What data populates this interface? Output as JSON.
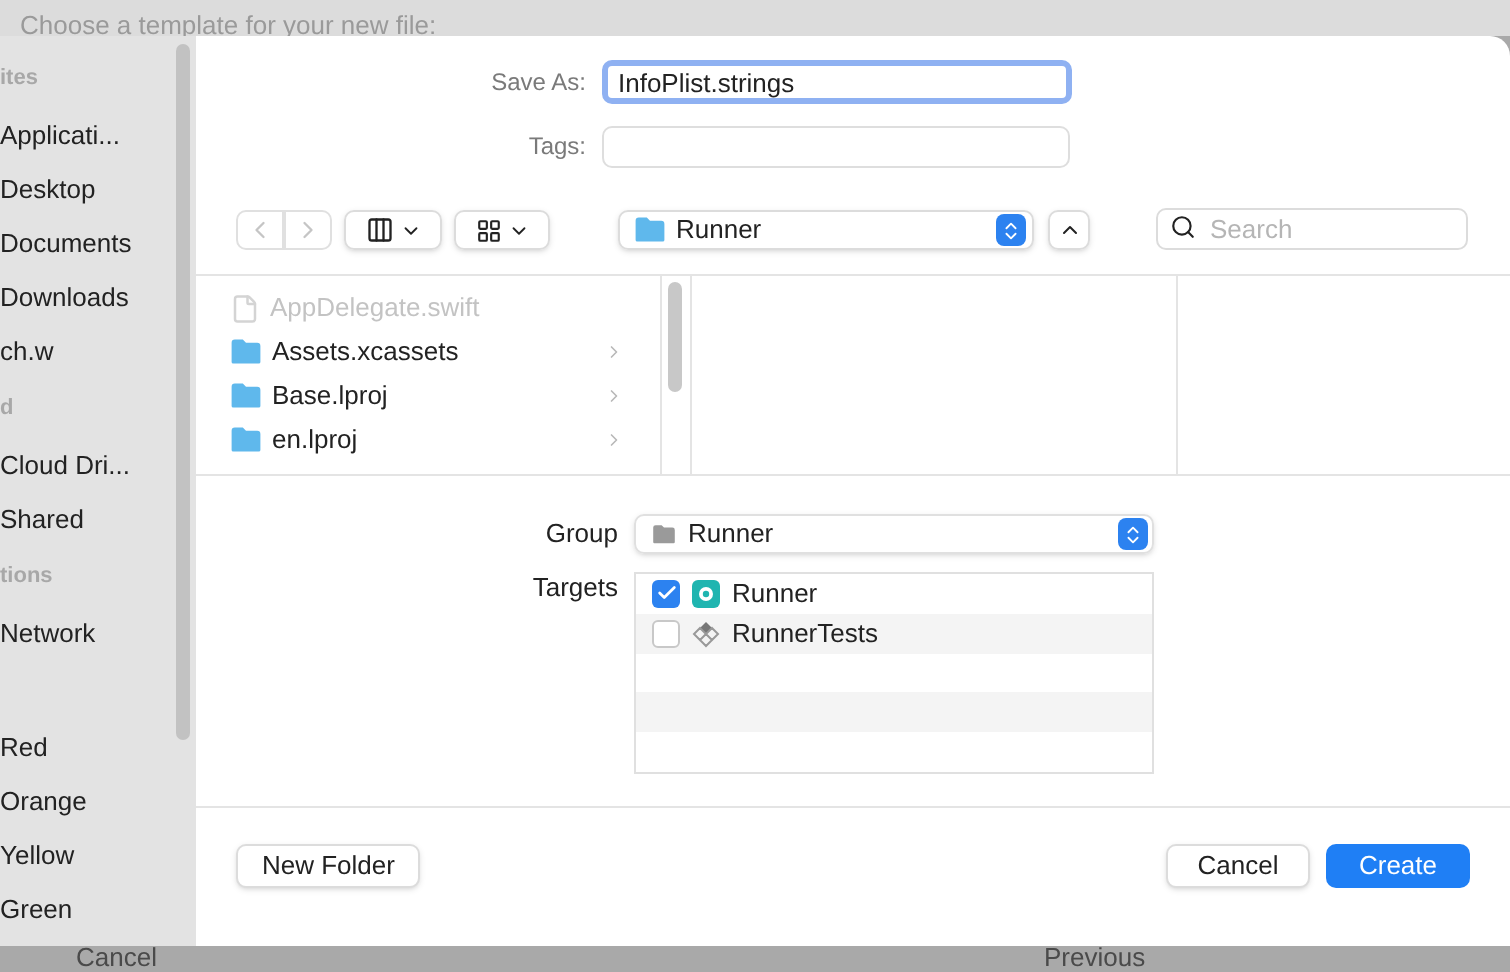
{
  "background": {
    "prompt": "Choose a template for your new file:",
    "buttons": [
      "Cancel",
      "Previous"
    ]
  },
  "sidebar": {
    "sections": [
      {
        "heading": "ites",
        "items": [
          "Applicati...",
          "Desktop",
          "Documents",
          "Downloads",
          "ch.w"
        ]
      },
      {
        "heading": "d",
        "items": [
          "Cloud Dri...",
          "Shared"
        ]
      },
      {
        "heading": "tions",
        "items": [
          "Network"
        ]
      },
      {
        "items": [
          "Red",
          "Orange",
          "Yellow",
          "Green"
        ]
      }
    ]
  },
  "save_as": {
    "label": "Save As:",
    "value": "InfoPlist.strings"
  },
  "tags": {
    "label": "Tags:"
  },
  "toolbar": {
    "location": "Runner",
    "search": {
      "placeholder": "Search"
    }
  },
  "browser": {
    "files": [
      {
        "name": "AppDelegate.swift",
        "kind": "file",
        "disabled": true
      },
      {
        "name": "Assets.xcassets",
        "kind": "folder",
        "disabled": false
      },
      {
        "name": "Base.lproj",
        "kind": "folder",
        "disabled": false
      },
      {
        "name": "en.lproj",
        "kind": "folder",
        "disabled": false
      }
    ]
  },
  "group": {
    "label": "Group",
    "value": "Runner"
  },
  "targets": {
    "label": "Targets",
    "items": [
      {
        "name": "Runner",
        "kind": "app",
        "checked": true
      },
      {
        "name": "RunnerTests",
        "kind": "tests",
        "checked": false
      }
    ]
  },
  "buttons": {
    "new_folder": "New Folder",
    "cancel": "Cancel",
    "create": "Create"
  }
}
